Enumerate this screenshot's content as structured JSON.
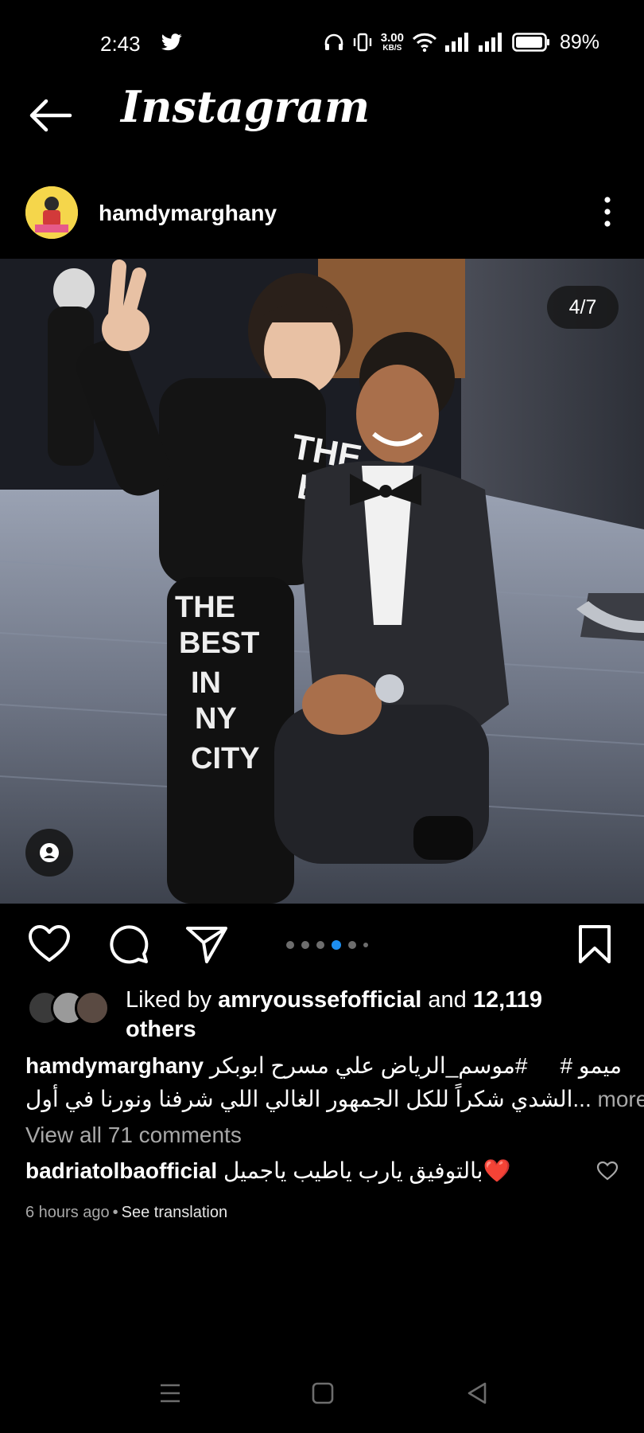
{
  "status_bar": {
    "time": "2:43",
    "net_speed_value": "3.00",
    "net_speed_unit": "KB/S",
    "battery": "89%"
  },
  "header": {
    "title": "Instagram"
  },
  "post": {
    "username": "hamdymarghany",
    "slide_counter": "4/7",
    "carousel_total": 6,
    "carousel_active_index": 3
  },
  "likes": {
    "prefix": "Liked by ",
    "user": "amryoussefofficial",
    "middle": " and ",
    "count": "12,119",
    "suffix": "others"
  },
  "caption": {
    "username": "hamdymarghany",
    "line1_text": "#موسم_الرياض  علي مسرح ابوبكر",
    "line1_end": "ميمو  #",
    "line2_text": "...الشدي شكراً للكل الجمهور الغالي اللي شرفنا ونورنا في أول",
    "more_label": "more"
  },
  "comments": {
    "view_all": "View all 71 comments",
    "items": [
      {
        "user": "badriatolbaofficial",
        "text": "بالتوفيق يارب ياطيب ياجميل",
        "emoji": "❤️"
      }
    ]
  },
  "meta": {
    "time_ago": "6 hours ago",
    "separator": "•",
    "see_translation": "See translation"
  },
  "colors": {
    "background": "#000000",
    "secondary_text": "#a8a8a8",
    "carousel_active": "#1d8ff2",
    "heart_red": "#e0262f"
  }
}
